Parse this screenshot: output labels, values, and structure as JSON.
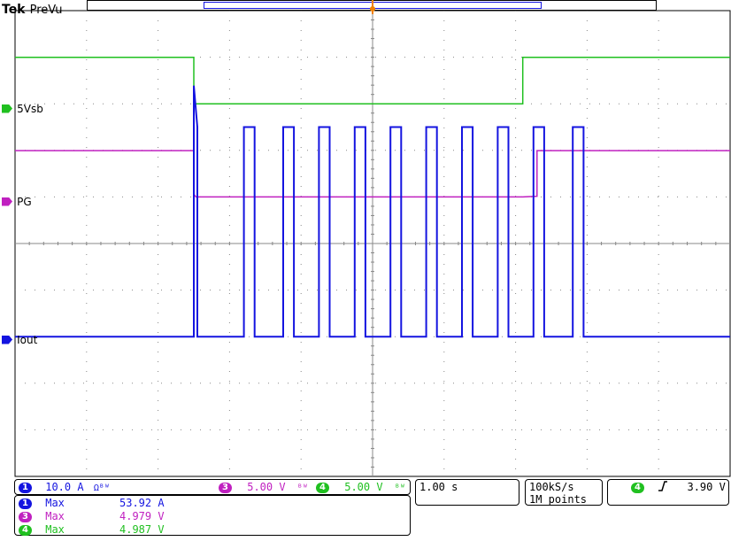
{
  "header": {
    "brand": "Tek",
    "mode": "PreVu"
  },
  "colors": {
    "ch1": "#1414e0",
    "ch3": "#c020c0",
    "ch4": "#20c020",
    "grid": "#888888",
    "trigger": "#f08000"
  },
  "channels": [
    {
      "id": "4",
      "label": "5Vsb",
      "color_key": "ch4"
    },
    {
      "id": "3",
      "label": "PG",
      "color_key": "ch3"
    },
    {
      "id": "1",
      "label": "Iout",
      "color_key": "ch1"
    }
  ],
  "settings": {
    "ch1": {
      "num": "1",
      "scale": "10.0 A",
      "flag": "Ωᴮᵂ"
    },
    "ch3": {
      "num": "3",
      "scale": "5.00 V",
      "flag": "ᴮᵂ"
    },
    "ch4": {
      "num": "4",
      "scale": "5.00 V",
      "flag": "ᴮᵂ"
    },
    "timebase": "1.00 s",
    "sample_rate": "100kS/s",
    "record_length": "1M points",
    "trigger": {
      "num": "4",
      "slope_icon": "rising-edge",
      "level": "3.90 V"
    }
  },
  "measurements": [
    {
      "num": "1",
      "label": "Max",
      "value": "53.92 A",
      "color_key": "ch1"
    },
    {
      "num": "3",
      "label": "Max",
      "value": "4.979 V",
      "color_key": "ch3"
    },
    {
      "num": "4",
      "label": "Max",
      "value": "4.987 V",
      "color_key": "ch4"
    }
  ],
  "chart_data": {
    "type": "line",
    "title": "",
    "xlabel": "",
    "ylabel": "",
    "x_units": "s",
    "xlim": [
      -5,
      5
    ],
    "grid": true,
    "divisions": {
      "x": 10,
      "y": 10
    },
    "series": [
      {
        "name": "5Vsb",
        "channel": "4",
        "units": "V",
        "volts_per_div": 5.0,
        "baseline_div": 3.0,
        "points": [
          [
            -5,
            4.98
          ],
          [
            -2.5,
            4.98
          ],
          [
            -2.5,
            0.0
          ],
          [
            0.2,
            0.0
          ],
          [
            0.2,
            0.0
          ],
          [
            2.1,
            0.0
          ],
          [
            2.1,
            4.98
          ],
          [
            5,
            4.98
          ]
        ]
      },
      {
        "name": "PG",
        "channel": "3",
        "units": "V",
        "volts_per_div": 5.0,
        "baseline_div": 1.0,
        "points": [
          [
            -5,
            4.97
          ],
          [
            -2.5,
            4.97
          ],
          [
            -2.5,
            0.3
          ],
          [
            -2.47,
            0.0
          ],
          [
            2.1,
            0.0
          ],
          [
            2.3,
            0.08
          ],
          [
            2.3,
            4.97
          ],
          [
            5,
            4.97
          ]
        ]
      },
      {
        "name": "Iout",
        "channel": "1",
        "units": "A",
        "amps_per_div": 10.0,
        "baseline_div": -2.0,
        "points": [
          [
            -5,
            0
          ],
          [
            -2.5,
            0
          ],
          [
            -2.5,
            53.9
          ],
          [
            -2.45,
            45.0
          ],
          [
            -2.45,
            0
          ],
          [
            -1.8,
            0
          ],
          [
            -1.8,
            45.0
          ],
          [
            -1.65,
            45.0
          ],
          [
            -1.65,
            0
          ],
          [
            -1.25,
            0
          ],
          [
            -1.25,
            45.0
          ],
          [
            -1.1,
            45.0
          ],
          [
            -1.1,
            0
          ],
          [
            -0.75,
            0
          ],
          [
            -0.75,
            45.0
          ],
          [
            -0.6,
            45.0
          ],
          [
            -0.6,
            0
          ],
          [
            -0.25,
            0
          ],
          [
            -0.25,
            45.0
          ],
          [
            -0.1,
            45.0
          ],
          [
            -0.1,
            0
          ],
          [
            0.25,
            0
          ],
          [
            0.25,
            45.0
          ],
          [
            0.4,
            45.0
          ],
          [
            0.4,
            0
          ],
          [
            0.75,
            0
          ],
          [
            0.75,
            45.0
          ],
          [
            0.9,
            45.0
          ],
          [
            0.9,
            0
          ],
          [
            1.25,
            0
          ],
          [
            1.25,
            45.0
          ],
          [
            1.4,
            45.0
          ],
          [
            1.4,
            0
          ],
          [
            1.75,
            0
          ],
          [
            1.75,
            45.0
          ],
          [
            1.9,
            45.0
          ],
          [
            1.9,
            0
          ],
          [
            2.25,
            0
          ],
          [
            2.25,
            45.0
          ],
          [
            2.4,
            45.0
          ],
          [
            2.4,
            0
          ],
          [
            2.8,
            0
          ],
          [
            2.8,
            45.0
          ],
          [
            2.95,
            45.0
          ],
          [
            2.95,
            0
          ],
          [
            5,
            0
          ]
        ]
      }
    ]
  }
}
